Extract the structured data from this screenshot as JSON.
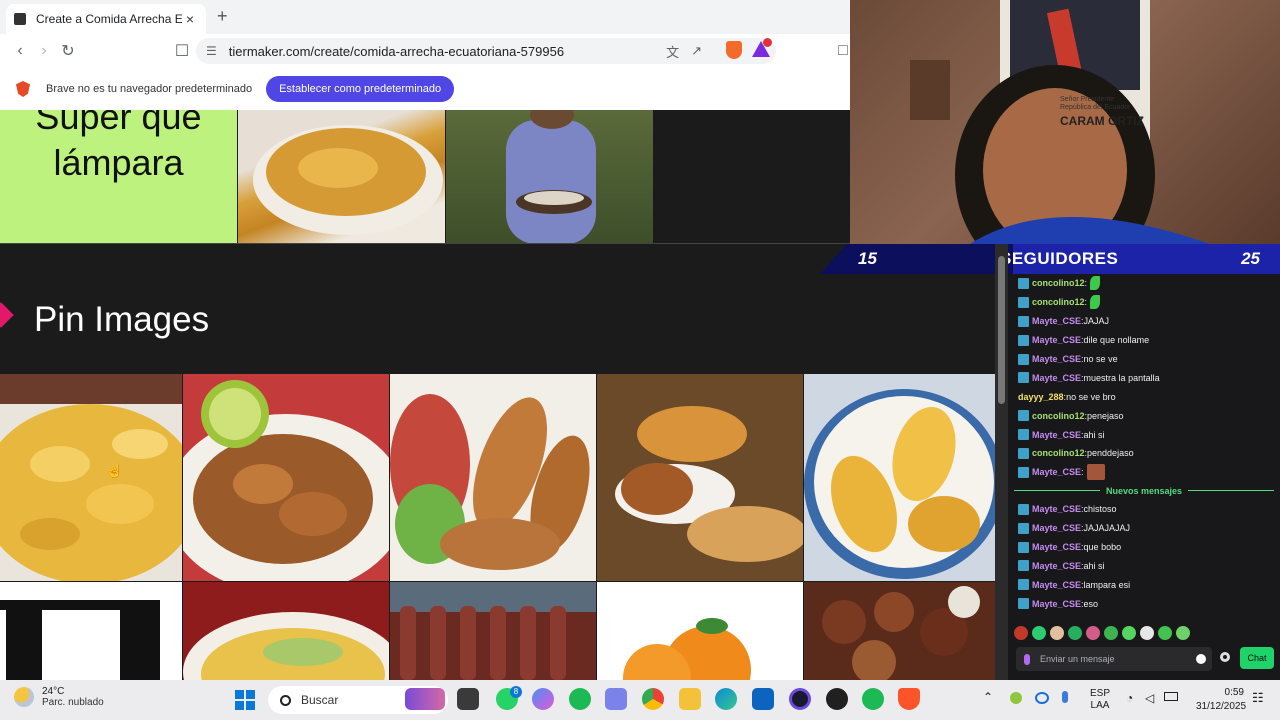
{
  "browser": {
    "tab_title": "Create a Comida Arrecha Ecuatoriana",
    "tab_close": "×",
    "new_tab": "+",
    "url": "tiermaker.com/create/comida-arrecha-ecuatoriana-579956",
    "shield_count": "",
    "infobar_text": "Brave no es tu navegador predeterminado",
    "infobar_button": "Establecer como predeterminado"
  },
  "page": {
    "tier_label_line1": "Súper que",
    "tier_label_line2": "lámpara",
    "tier_label_color": "#bef27f",
    "pin_title": "Pin Images"
  },
  "webcam": {
    "portrait_text_1": "Señor Presidente",
    "portrait_text_2": "República del Ecuador",
    "portrait_text_3": "CARAM ORTIZ"
  },
  "followers": {
    "current": "15",
    "label": "SEGUIDORES",
    "goal": "25",
    "progress": 0.6
  },
  "chat": {
    "messages": [
      {
        "user": "concolino12",
        "color": "#a5e16f",
        "text": "",
        "emote": "green"
      },
      {
        "user": "concolino12",
        "color": "#a5e16f",
        "text": "",
        "emote": "green"
      },
      {
        "user": "Mayte_CSE",
        "color": "#c58cf0",
        "text": "JAJAJ"
      },
      {
        "user": "Mayte_CSE",
        "color": "#c58cf0",
        "text": "dile que nollame"
      },
      {
        "user": "Mayte_CSE",
        "color": "#c58cf0",
        "text": "no se ve"
      },
      {
        "user": "Mayte_CSE",
        "color": "#c58cf0",
        "text": "muestra la pantalla"
      },
      {
        "user": "dayyy_288",
        "color": "#f1e06b",
        "text": "no se ve bro",
        "no_icon": true
      },
      {
        "user": "concolino12",
        "color": "#a5e16f",
        "text": "penejaso"
      },
      {
        "user": "Mayte_CSE",
        "color": "#c58cf0",
        "text": "ahi si"
      },
      {
        "user": "concolino12",
        "color": "#a5e16f",
        "text": "penddejaso"
      },
      {
        "user": "Mayte_CSE",
        "color": "#c58cf0",
        "text": "",
        "emote": "image"
      }
    ],
    "new_messages_label": "Nuevos mensajes",
    "new_messages": [
      {
        "user": "Mayte_CSE",
        "color": "#c58cf0",
        "text": "chistoso"
      },
      {
        "user": "Mayte_CSE",
        "color": "#c58cf0",
        "text": "JAJAJAJAJ"
      },
      {
        "user": "Mayte_CSE",
        "color": "#c58cf0",
        "text": "que bobo"
      },
      {
        "user": "Mayte_CSE",
        "color": "#c58cf0",
        "text": "ahi si"
      },
      {
        "user": "Mayte_CSE",
        "color": "#c58cf0",
        "text": "lampara esi"
      },
      {
        "user": "Mayte_CSE",
        "color": "#c58cf0",
        "text": "eso"
      }
    ],
    "input_placeholder": "Enviar un mensaje",
    "send_button": "Chat"
  },
  "taskbar": {
    "temperature": "24°C",
    "weather": "Parc. nublado",
    "search_placeholder": "Buscar",
    "whatsapp_badge": "8",
    "language": "ESP",
    "layout": "LAA",
    "time": "0:59",
    "date": "31/12/2025"
  }
}
